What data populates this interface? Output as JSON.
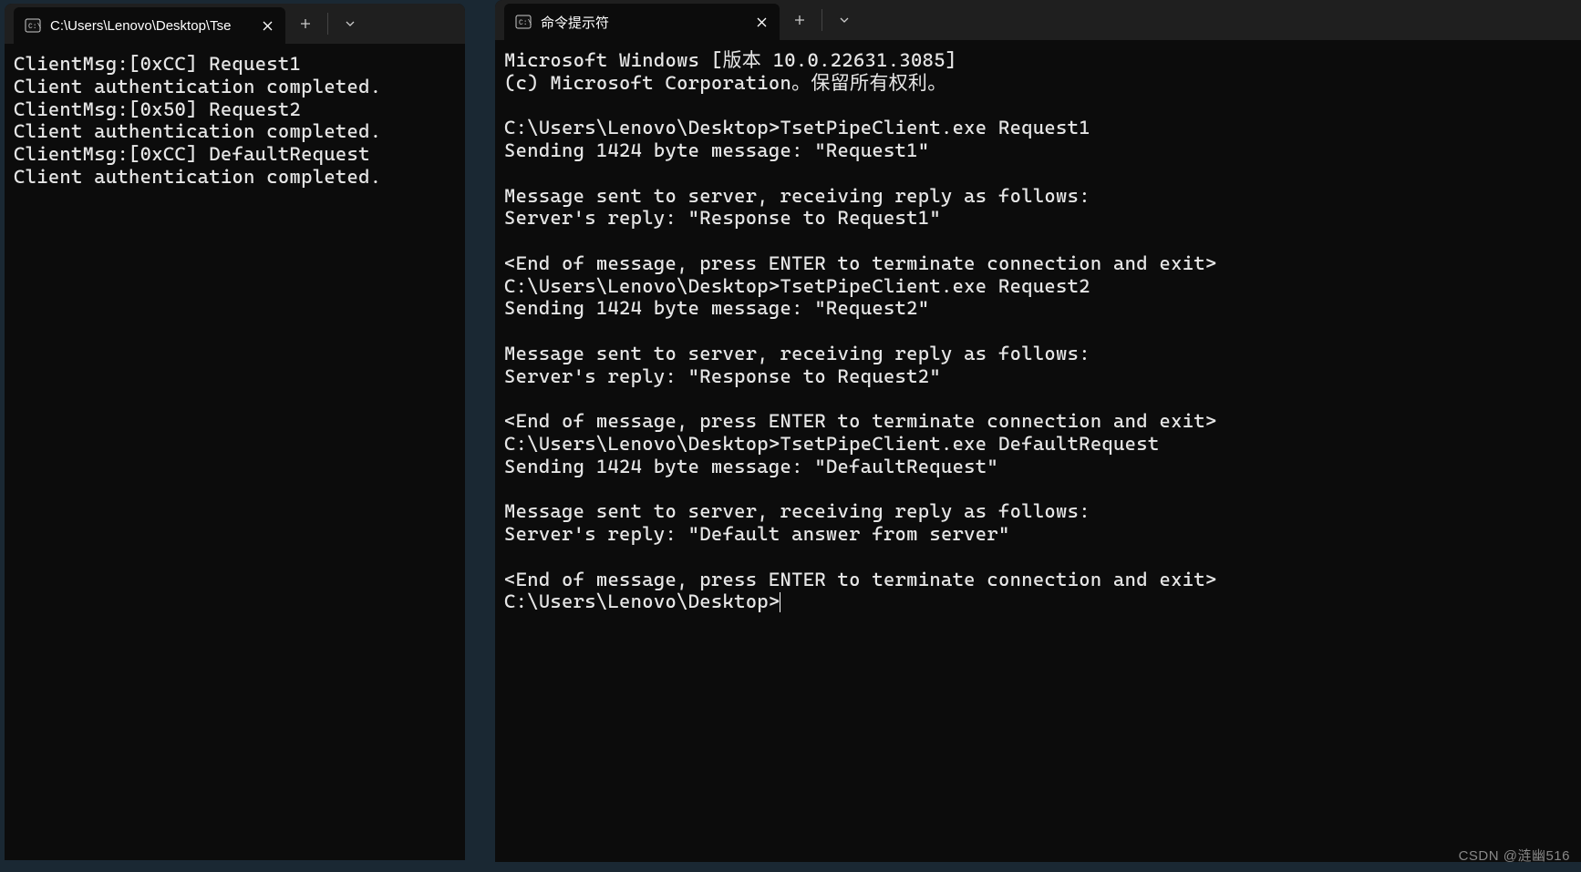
{
  "leftWindow": {
    "tab": {
      "title": "C:\\Users\\Lenovo\\Desktop\\Tse"
    },
    "lines": [
      "ClientMsg:[0xCC] Request1",
      "Client authentication completed.",
      "ClientMsg:[0x50] Request2",
      "Client authentication completed.",
      "ClientMsg:[0xCC] DefaultRequest",
      "Client authentication completed."
    ]
  },
  "rightWindow": {
    "tab": {
      "title": "命令提示符"
    },
    "lines": [
      "Microsoft Windows [版本 10.0.22631.3085]",
      "(c) Microsoft Corporation。保留所有权利。",
      "",
      "C:\\Users\\Lenovo\\Desktop>TsetPipeClient.exe Request1",
      "Sending 1424 byte message: \"Request1\"",
      "",
      "Message sent to server, receiving reply as follows:",
      "Server's reply: \"Response to Request1\"",
      "",
      "<End of message, press ENTER to terminate connection and exit>",
      "C:\\Users\\Lenovo\\Desktop>TsetPipeClient.exe Request2",
      "Sending 1424 byte message: \"Request2\"",
      "",
      "Message sent to server, receiving reply as follows:",
      "Server's reply: \"Response to Request2\"",
      "",
      "<End of message, press ENTER to terminate connection and exit>",
      "C:\\Users\\Lenovo\\Desktop>TsetPipeClient.exe DefaultRequest",
      "Sending 1424 byte message: \"DefaultRequest\"",
      "",
      "Message sent to server, receiving reply as follows:",
      "Server's reply: \"Default answer from server\"",
      "",
      "<End of message, press ENTER to terminate connection and exit>",
      "C:\\Users\\Lenovo\\Desktop>"
    ]
  },
  "watermark": "CSDN @涟幽516"
}
